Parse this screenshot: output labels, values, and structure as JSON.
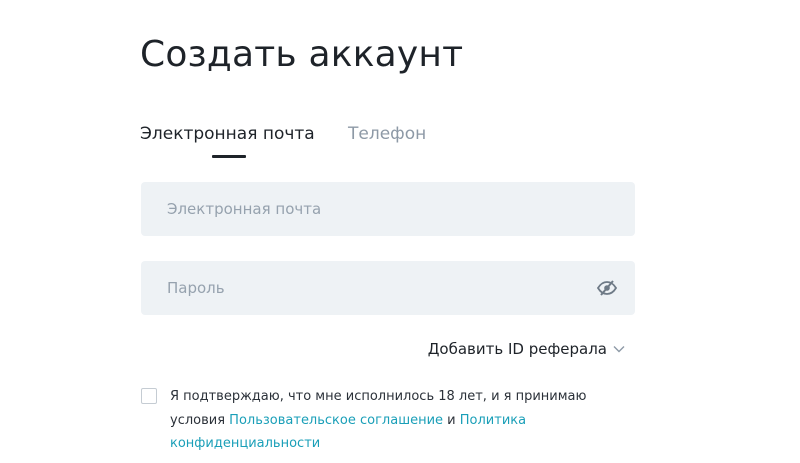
{
  "page": {
    "title": "Создать аккаунт"
  },
  "tabs": [
    {
      "label": "Электронная почта",
      "active": true
    },
    {
      "label": "Телефон",
      "active": false
    }
  ],
  "form": {
    "email_placeholder": "Электронная почта",
    "email_value": "",
    "password_placeholder": "Пароль",
    "password_value": "",
    "password_toggle_icon": "eye-off-icon",
    "referral_label": "Добавить ID реферала",
    "referral_icon": "chevron-down-icon"
  },
  "consent": {
    "checked": false,
    "text_before": "Я подтверждаю, что мне исполнилось 18 лет, и я принимаю условия ",
    "terms_link": "Пользовательское соглашение",
    "and": " и ",
    "privacy_link": "Политика конфиденциальности"
  },
  "colors": {
    "text": "#1e2329",
    "muted": "#8d99a6",
    "field_bg": "#eef2f5",
    "link": "#1a9fb8"
  }
}
